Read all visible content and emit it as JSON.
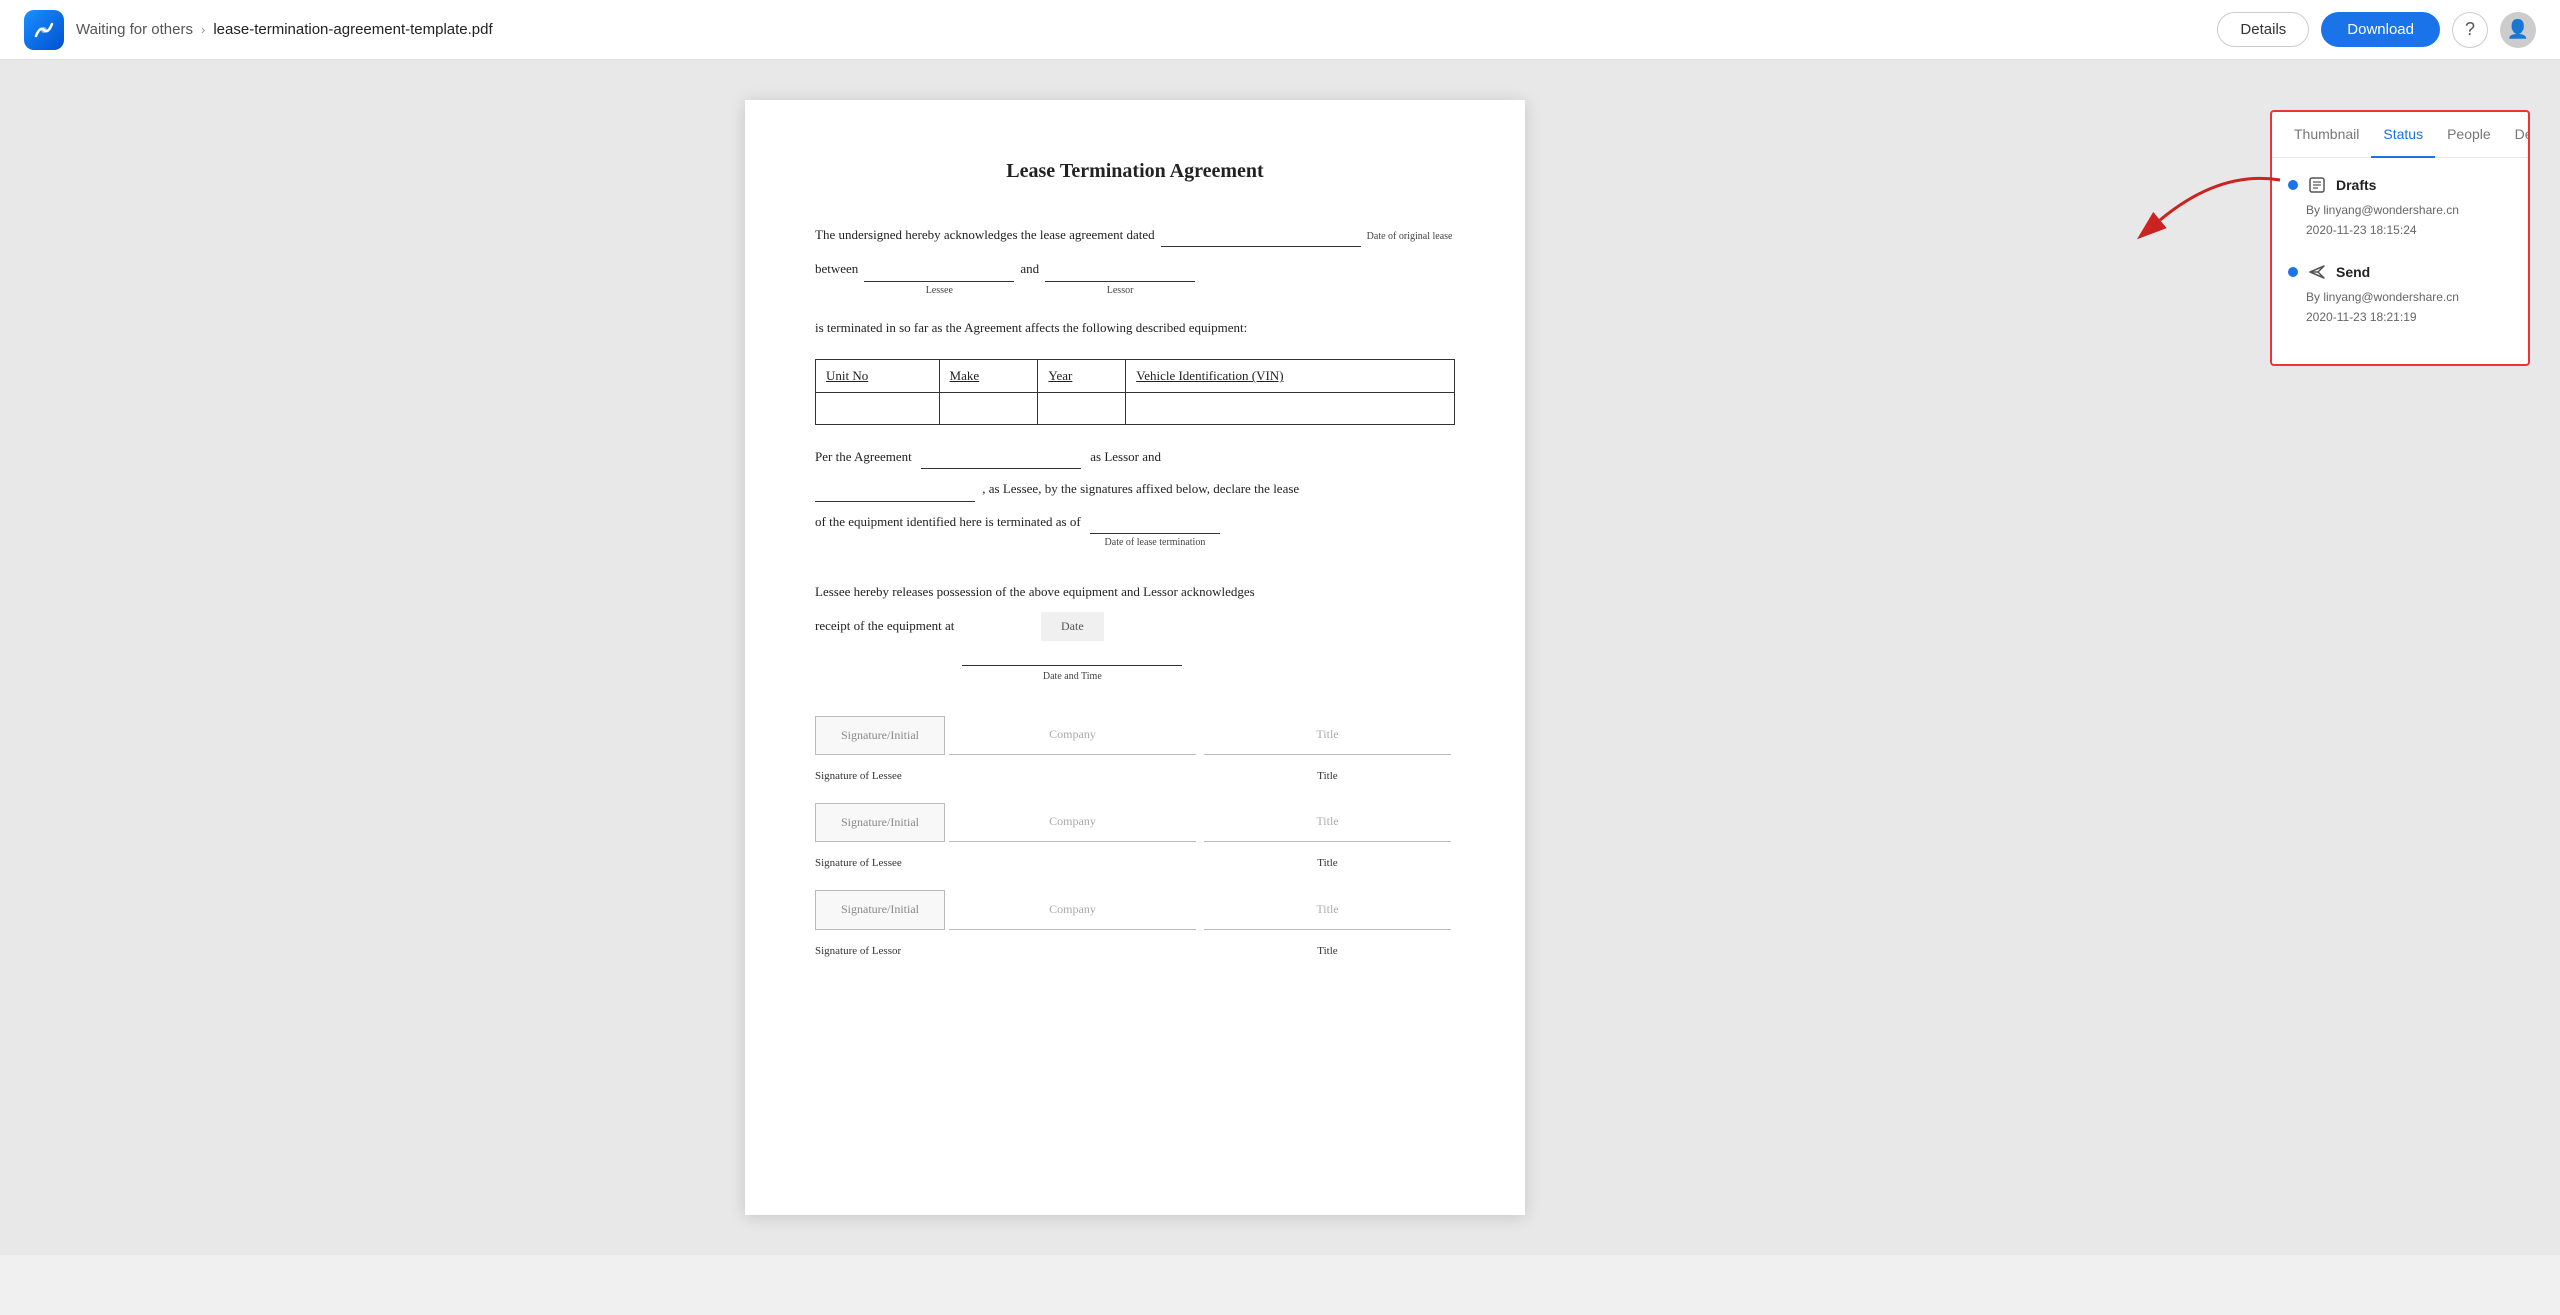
{
  "header": {
    "breadcrumb_link": "Waiting for others",
    "breadcrumb_sep": "›",
    "breadcrumb_current": "lease-termination-agreement-template.pdf",
    "btn_details": "Details",
    "btn_download": "Download"
  },
  "panel": {
    "tabs": [
      "Thumbnail",
      "Status",
      "People",
      "Details"
    ],
    "active_tab": "Status",
    "status_items": [
      {
        "dot": true,
        "icon": "📋",
        "name": "Drafts",
        "by": "By linyang@wondershare.cn",
        "date": "2020-11-23 18:15:24"
      },
      {
        "dot": true,
        "icon": "➤",
        "name": "Send",
        "by": "By linyang@wondershare.cn",
        "date": "2020-11-23 18:21:19"
      }
    ]
  },
  "pdf": {
    "title": "Lease Termination Agreement",
    "p1": "The undersigned hereby acknowledges the lease agreement dated",
    "p1_field_label": "Date of original lease",
    "p2_prefix": "between",
    "p2_lessee_label": "Lessee",
    "p2_and": "and",
    "p2_lessor_label": "Lessor",
    "p3": "is terminated in so far as the Agreement affects the following described equipment:",
    "table_headers": [
      "Unit No",
      "Make",
      "Year",
      "Vehicle Identification (VIN)"
    ],
    "p4": "Per the Agreement",
    "p4_suffix": "as Lessor and",
    "p5_suffix": ", as Lessee, by the signatures affixed below, declare the lease",
    "p6": "of the equipment identified here is terminated as of",
    "p6_field_label": "Date of lease termination",
    "p7": "Lessee hereby releases possession of the above equipment and Lessor acknowledges",
    "p8": "receipt of the equipment at",
    "date_label": "Date and Time",
    "date_placeholder": "Date",
    "sig_rows": [
      {
        "sig": "Signature/Initial",
        "company": "Company",
        "title": "Title",
        "label": "Signature of Lessee"
      },
      {
        "sig": "Signature/Initial",
        "company": "Company",
        "title": "Title",
        "label": "Signature of Lessee"
      },
      {
        "sig": "Signature/Initial",
        "company": "Company",
        "title": "Title",
        "label": "Signature of Lessor"
      }
    ]
  }
}
